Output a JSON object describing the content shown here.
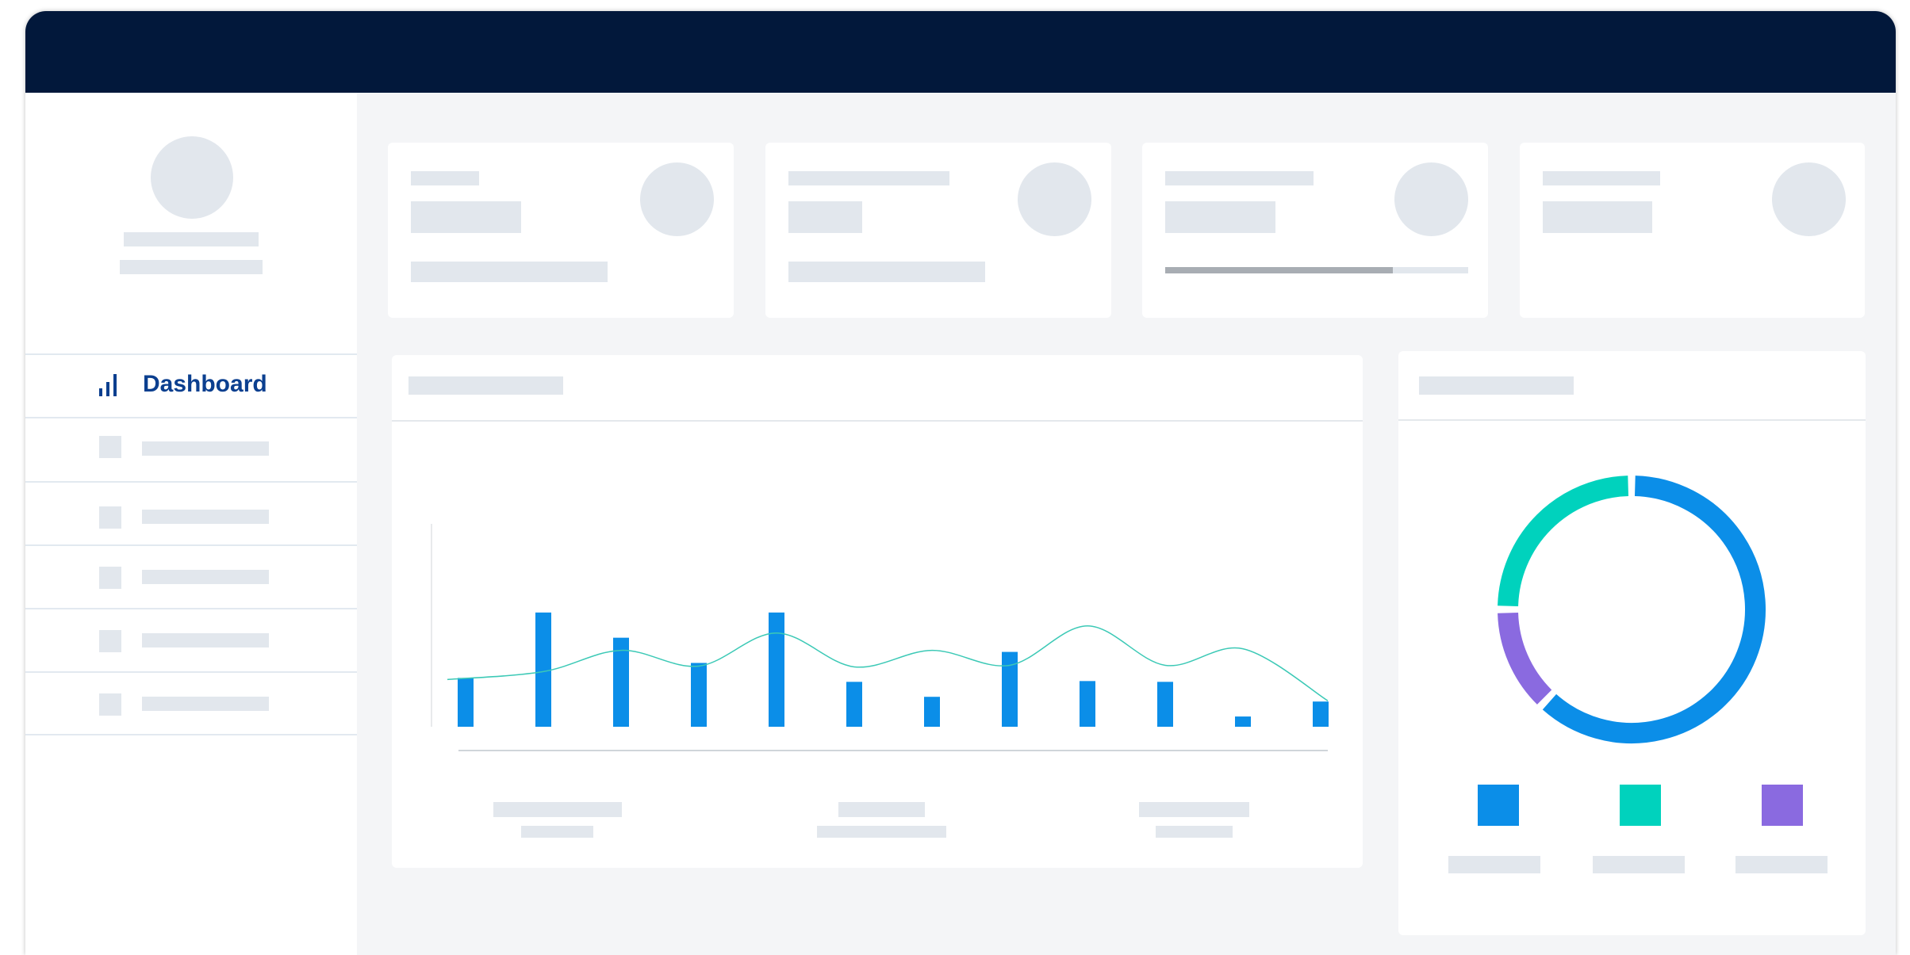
{
  "sidebar": {
    "items": [
      {
        "label": "Dashboard",
        "icon": "bar-chart-icon",
        "active": true
      },
      {
        "label": "",
        "icon": "placeholder-icon"
      },
      {
        "label": "",
        "icon": "placeholder-icon"
      },
      {
        "label": "",
        "icon": "placeholder-icon"
      },
      {
        "label": "",
        "icon": "placeholder-icon"
      },
      {
        "label": "",
        "icon": "placeholder-icon"
      }
    ]
  },
  "stats": {
    "card3_progress_fraction": 0.75
  },
  "colors": {
    "header": "#02183b",
    "accent_blue": "#0b8ee8",
    "accent_teal": "#00d2bd",
    "accent_purple": "#8a6ae0",
    "nav_active": "#0b3f8f"
  },
  "chart_data": [
    {
      "type": "bar",
      "bar_values": [
        62,
        145,
        113,
        81,
        145,
        57,
        38,
        95,
        58,
        57,
        13,
        32
      ],
      "line_values": [
        60,
        70,
        97,
        77,
        119,
        76,
        97,
        78,
        128,
        78,
        99,
        33
      ],
      "ylim": [
        0,
        170
      ]
    },
    {
      "type": "pie",
      "slices": [
        {
          "color": "#0b8ee8",
          "value": 0.62
        },
        {
          "color": "#8a6ae0",
          "value": 0.13
        },
        {
          "color": "#00d2bd",
          "value": 0.25
        }
      ],
      "legend": [
        {
          "color": "#0b8ee8"
        },
        {
          "color": "#00d2bd"
        },
        {
          "color": "#8a6ae0"
        }
      ]
    }
  ]
}
